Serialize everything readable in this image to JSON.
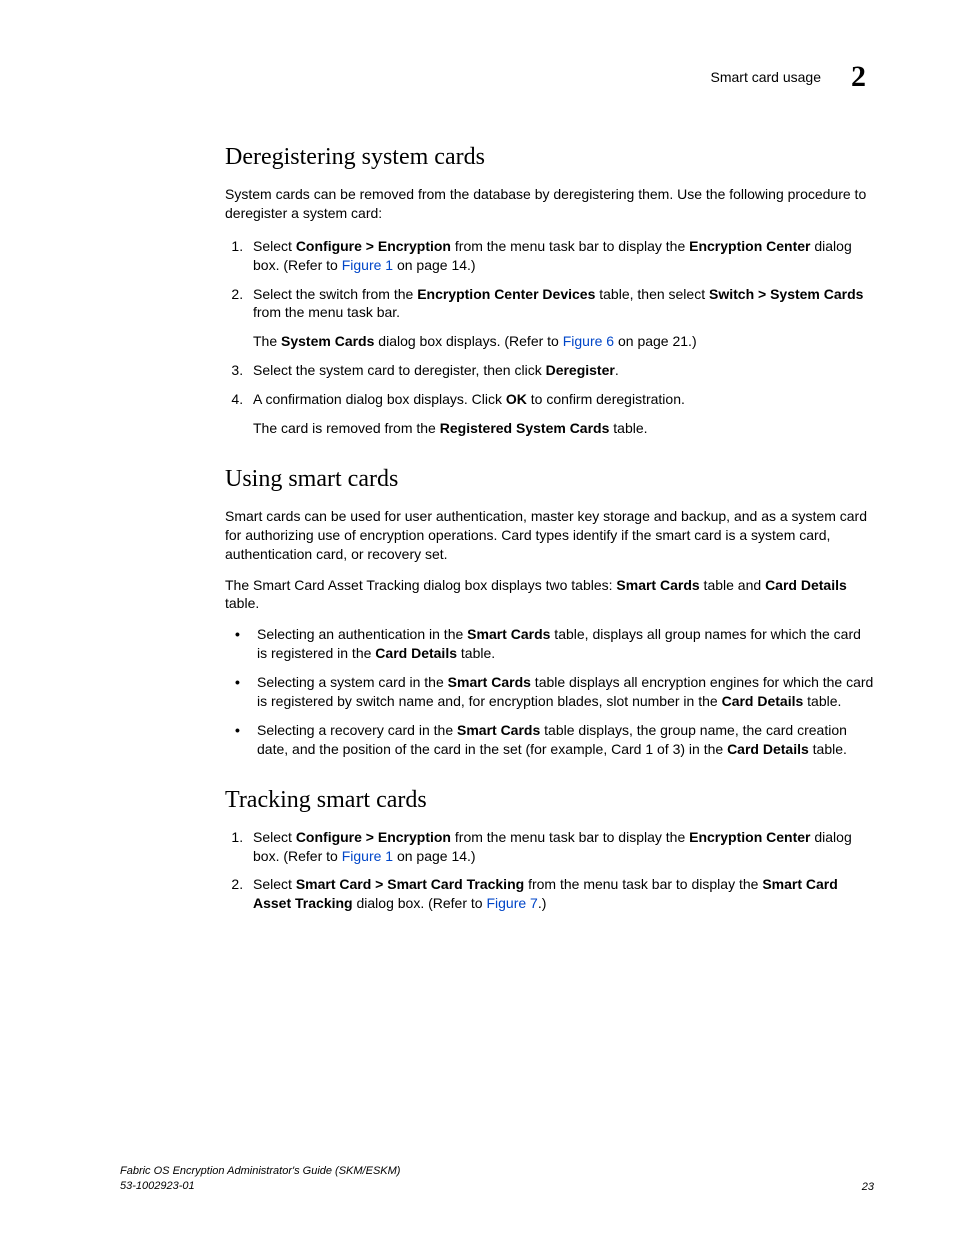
{
  "header": {
    "title": "Smart card usage",
    "chapter": "2"
  },
  "section1": {
    "heading": "Deregistering system cards",
    "intro": "System cards can be removed from the database by deregistering them. Use the following procedure to deregister a system card:",
    "step1_a": "Select ",
    "step1_b": "Configure > Encryption",
    "step1_c": " from the menu task bar to display the ",
    "step1_d": "Encryption Center",
    "step1_e": " dialog box. (Refer to ",
    "step1_link": "Figure 1",
    "step1_f": " on page 14.)",
    "step2_a": "Select the switch from the ",
    "step2_b": "Encryption Center Devices",
    "step2_c": " table, then select ",
    "step2_d": "Switch > System Cards",
    "step2_e": " from the menu task bar.",
    "step2_note_a": "The ",
    "step2_note_b": "System Cards",
    "step2_note_c": " dialog box displays. (Refer to ",
    "step2_note_link": "Figure 6",
    "step2_note_d": " on page 21.)",
    "step3_a": "Select the system card to deregister, then click ",
    "step3_b": "Deregister",
    "step3_c": ".",
    "step4_a": "A confirmation dialog box displays. Click ",
    "step4_b": "OK",
    "step4_c": " to confirm deregistration.",
    "step4_note_a": "The card is removed from the ",
    "step4_note_b": "Registered System Cards",
    "step4_note_c": " table."
  },
  "section2": {
    "heading": "Using smart cards",
    "para1": "Smart cards can be used for user authentication, master key storage and backup, and as a system card for authorizing use of encryption operations. Card types identify if the smart card is a system card, authentication card, or recovery set.",
    "para2_a": "The Smart Card Asset Tracking dialog box displays two tables: ",
    "para2_b": "Smart Cards",
    "para2_c": " table and ",
    "para2_d": "Card Details",
    "para2_e": " table.",
    "bullet1_a": "Selecting an authentication in the ",
    "bullet1_b": "Smart Cards",
    "bullet1_c": " table, displays all group names for which the card is registered in the ",
    "bullet1_d": "Card Details",
    "bullet1_e": " table.",
    "bullet2_a": "Selecting a system card in the ",
    "bullet2_b": "Smart Cards",
    "bullet2_c": " table displays all encryption engines for which the card is registered by switch name and, for encryption blades, slot number in the ",
    "bullet2_d": "Card Details",
    "bullet2_e": " table.",
    "bullet3_a": "Selecting a recovery card in the ",
    "bullet3_b": "Smart Cards",
    "bullet3_c": " table displays, the group name, the card creation date, and the position of the card in the set (for example, Card 1 of 3) in the ",
    "bullet3_d": "Card Details",
    "bullet3_e": " table."
  },
  "section3": {
    "heading": "Tracking smart cards",
    "step1_a": "Select ",
    "step1_b": "Configure > Encryption",
    "step1_c": " from the menu task bar to display the ",
    "step1_d": "Encryption Center",
    "step1_e": " dialog box. (Refer to ",
    "step1_link": "Figure 1",
    "step1_f": " on page 14.)",
    "step2_a": "Select ",
    "step2_b": "Smart Card > Smart Card Tracking",
    "step2_c": " from the menu task bar to display the ",
    "step2_d": "Smart Card Asset Tracking",
    "step2_e": " dialog box. (Refer to ",
    "step2_link": "Figure 7",
    "step2_f": ".)"
  },
  "footer": {
    "doc_title": "Fabric OS Encryption Administrator's Guide (SKM/ESKM)",
    "doc_number": "53-1002923-01",
    "page": "23"
  }
}
